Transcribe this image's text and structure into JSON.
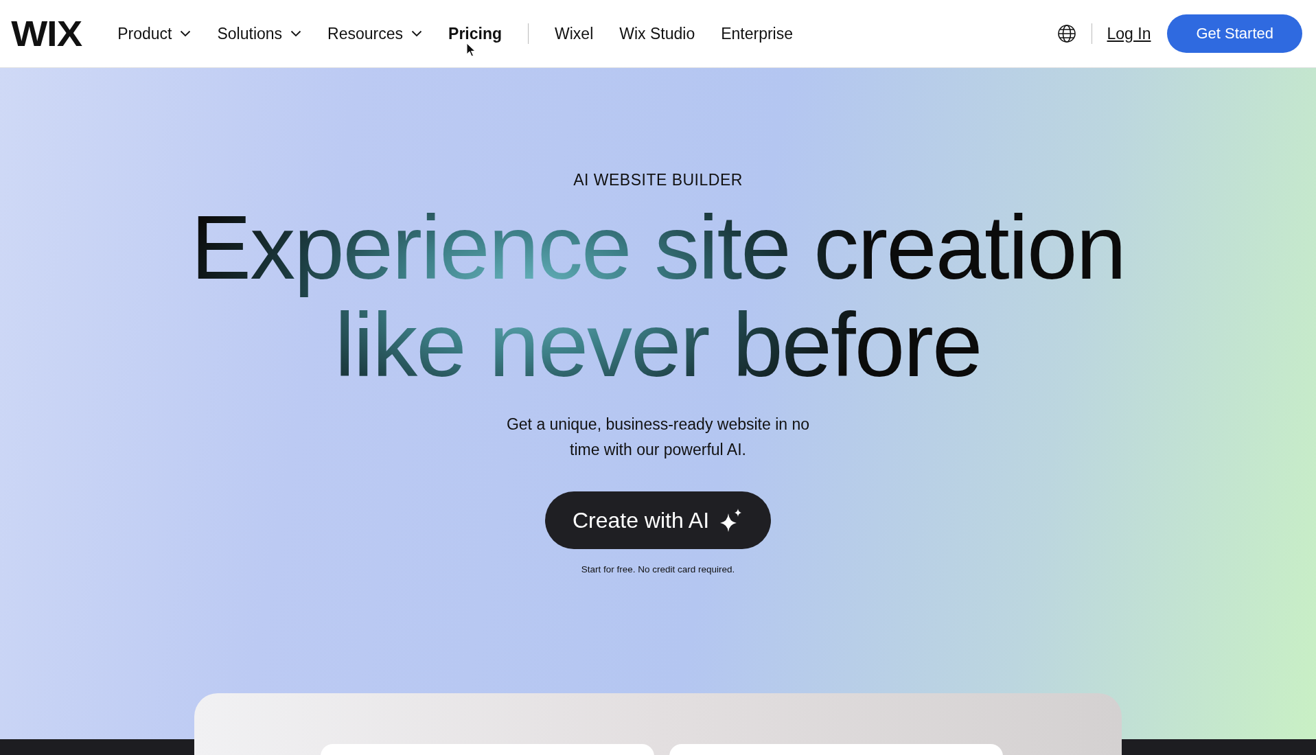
{
  "header": {
    "logo": "WIX",
    "nav": [
      {
        "label": "Product",
        "kind": "dropdown",
        "selected": false
      },
      {
        "label": "Solutions",
        "kind": "dropdown",
        "selected": false
      },
      {
        "label": "Resources",
        "kind": "dropdown",
        "selected": false
      },
      {
        "label": "Pricing",
        "kind": "link",
        "selected": true
      },
      {
        "kind": "divider"
      },
      {
        "label": "Wixel",
        "kind": "link",
        "selected": false
      },
      {
        "label": "Wix Studio",
        "kind": "link",
        "selected": false
      },
      {
        "label": "Enterprise",
        "kind": "link",
        "selected": false
      }
    ],
    "login": "Log In",
    "cta": "Get Started"
  },
  "hero": {
    "eyebrow": "AI WEBSITE BUILDER",
    "headline": [
      "Experience site creation",
      "like never before"
    ],
    "subtitle": "Get a unique, business-ready website in no time with our powerful AI.",
    "button": "Create with AI",
    "note": "Start for free. No credit card required."
  }
}
